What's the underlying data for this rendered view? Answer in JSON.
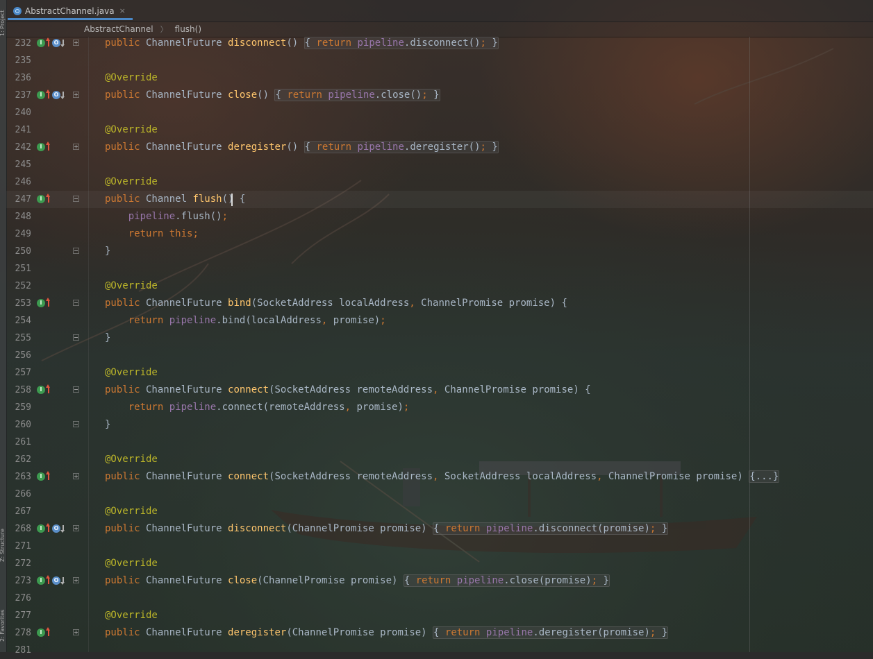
{
  "window": {
    "tab_label": "AbstractChannel.java",
    "tab_close": "×"
  },
  "breadcrumb": {
    "items": [
      "AbstractChannel",
      "flush()"
    ],
    "separator": "〉"
  },
  "tool_strip": {
    "labels": [
      "1: Project",
      "Z: Structure",
      "2: Favorites"
    ]
  },
  "colors": {
    "keyword": "#cc7832",
    "annotation": "#bbb529",
    "method": "#ffc66d",
    "field": "#9876aa",
    "text": "#a9b7c6",
    "line_number": "#8c8c8c",
    "tab_underline": "#4a88c7"
  },
  "gutter_legend": {
    "impl": "I",
    "over": "O"
  },
  "current_line": "247",
  "editor": {
    "lines": [
      {
        "num": "232",
        "markers": [
          "impl",
          "up",
          "over",
          "down"
        ],
        "fold": "plus",
        "tokens": [
          [
            "kw",
            "public"
          ],
          [
            "pl",
            " ChannelFuture "
          ],
          [
            "fn",
            "disconnect"
          ],
          [
            "pl",
            "() "
          ],
          [
            "fb",
            "{ "
          ],
          [
            "fbk",
            "return"
          ],
          [
            "fb",
            " "
          ],
          [
            "fbf",
            "pipeline"
          ],
          [
            "fb",
            ".disconnect()"
          ],
          [
            "fbp",
            ";"
          ],
          [
            "fb",
            " }"
          ]
        ]
      },
      {
        "num": "235",
        "markers": [],
        "fold": "",
        "tokens": []
      },
      {
        "num": "236",
        "markers": [],
        "fold": "",
        "tokens": [
          [
            "an",
            "@Override"
          ]
        ]
      },
      {
        "num": "237",
        "markers": [
          "impl",
          "up",
          "over",
          "down"
        ],
        "fold": "plus",
        "tokens": [
          [
            "kw",
            "public"
          ],
          [
            "pl",
            " ChannelFuture "
          ],
          [
            "fn",
            "close"
          ],
          [
            "pl",
            "() "
          ],
          [
            "fb",
            "{ "
          ],
          [
            "fbk",
            "return"
          ],
          [
            "fb",
            " "
          ],
          [
            "fbf",
            "pipeline"
          ],
          [
            "fb",
            ".close()"
          ],
          [
            "fbp",
            ";"
          ],
          [
            "fb",
            " }"
          ]
        ]
      },
      {
        "num": "240",
        "markers": [],
        "fold": "",
        "tokens": []
      },
      {
        "num": "241",
        "markers": [],
        "fold": "",
        "tokens": [
          [
            "an",
            "@Override"
          ]
        ]
      },
      {
        "num": "242",
        "markers": [
          "impl",
          "up"
        ],
        "fold": "plus",
        "tokens": [
          [
            "kw",
            "public"
          ],
          [
            "pl",
            " ChannelFuture "
          ],
          [
            "fn",
            "deregister"
          ],
          [
            "pl",
            "() "
          ],
          [
            "fb",
            "{ "
          ],
          [
            "fbk",
            "return"
          ],
          [
            "fb",
            " "
          ],
          [
            "fbf",
            "pipeline"
          ],
          [
            "fb",
            ".deregister()"
          ],
          [
            "fbp",
            ";"
          ],
          [
            "fb",
            " }"
          ]
        ]
      },
      {
        "num": "245",
        "markers": [],
        "fold": "",
        "tokens": []
      },
      {
        "num": "246",
        "markers": [],
        "fold": "",
        "tokens": [
          [
            "an",
            "@Override"
          ]
        ]
      },
      {
        "num": "247",
        "markers": [
          "impl",
          "up"
        ],
        "fold": "open",
        "tokens": [
          [
            "kw",
            "public"
          ],
          [
            "pl",
            " Channel "
          ],
          [
            "fn",
            "flush"
          ],
          [
            "pl",
            "() {"
          ]
        ]
      },
      {
        "num": "248",
        "markers": [],
        "fold": "",
        "tokens": [
          [
            "pl",
            "    "
          ],
          [
            "fld",
            "pipeline"
          ],
          [
            "pl",
            ".flush()"
          ],
          [
            "pu",
            ";"
          ]
        ]
      },
      {
        "num": "249",
        "markers": [],
        "fold": "",
        "tokens": [
          [
            "pl",
            "    "
          ],
          [
            "kw",
            "return this"
          ],
          [
            "pu",
            ";"
          ]
        ]
      },
      {
        "num": "250",
        "markers": [],
        "fold": "end",
        "tokens": [
          [
            "pl",
            "}"
          ]
        ]
      },
      {
        "num": "251",
        "markers": [],
        "fold": "",
        "tokens": []
      },
      {
        "num": "252",
        "markers": [],
        "fold": "",
        "tokens": [
          [
            "an",
            "@Override"
          ]
        ]
      },
      {
        "num": "253",
        "markers": [
          "impl",
          "up"
        ],
        "fold": "open",
        "tokens": [
          [
            "kw",
            "public"
          ],
          [
            "pl",
            " ChannelFuture "
          ],
          [
            "fn",
            "bind"
          ],
          [
            "pl",
            "(SocketAddress localAddress"
          ],
          [
            "pu",
            ","
          ],
          [
            "pl",
            " ChannelPromise promise) {"
          ]
        ]
      },
      {
        "num": "254",
        "markers": [],
        "fold": "",
        "tokens": [
          [
            "pl",
            "    "
          ],
          [
            "kw",
            "return "
          ],
          [
            "fld",
            "pipeline"
          ],
          [
            "pl",
            ".bind(localAddress"
          ],
          [
            "pu",
            ","
          ],
          [
            "pl",
            " promise)"
          ],
          [
            "pu",
            ";"
          ]
        ]
      },
      {
        "num": "255",
        "markers": [],
        "fold": "end",
        "tokens": [
          [
            "pl",
            "}"
          ]
        ]
      },
      {
        "num": "256",
        "markers": [],
        "fold": "",
        "tokens": []
      },
      {
        "num": "257",
        "markers": [],
        "fold": "",
        "tokens": [
          [
            "an",
            "@Override"
          ]
        ]
      },
      {
        "num": "258",
        "markers": [
          "impl",
          "up"
        ],
        "fold": "open",
        "tokens": [
          [
            "kw",
            "public"
          ],
          [
            "pl",
            " ChannelFuture "
          ],
          [
            "fn",
            "connect"
          ],
          [
            "pl",
            "(SocketAddress remoteAddress"
          ],
          [
            "pu",
            ","
          ],
          [
            "pl",
            " ChannelPromise promise) {"
          ]
        ]
      },
      {
        "num": "259",
        "markers": [],
        "fold": "",
        "tokens": [
          [
            "pl",
            "    "
          ],
          [
            "kw",
            "return "
          ],
          [
            "fld",
            "pipeline"
          ],
          [
            "pl",
            ".connect(remoteAddress"
          ],
          [
            "pu",
            ","
          ],
          [
            "pl",
            " promise)"
          ],
          [
            "pu",
            ";"
          ]
        ]
      },
      {
        "num": "260",
        "markers": [],
        "fold": "end",
        "tokens": [
          [
            "pl",
            "}"
          ]
        ]
      },
      {
        "num": "261",
        "markers": [],
        "fold": "",
        "tokens": []
      },
      {
        "num": "262",
        "markers": [],
        "fold": "",
        "tokens": [
          [
            "an",
            "@Override"
          ]
        ]
      },
      {
        "num": "263",
        "markers": [
          "impl",
          "up"
        ],
        "fold": "plus",
        "tokens": [
          [
            "kw",
            "public"
          ],
          [
            "pl",
            " ChannelFuture "
          ],
          [
            "fn",
            "connect"
          ],
          [
            "pl",
            "(SocketAddress remoteAddress"
          ],
          [
            "pu",
            ","
          ],
          [
            "pl",
            " SocketAddress localAddress"
          ],
          [
            "pu",
            ","
          ],
          [
            "pl",
            " ChannelPromise promise) "
          ],
          [
            "fb",
            "{...}"
          ]
        ]
      },
      {
        "num": "266",
        "markers": [],
        "fold": "",
        "tokens": []
      },
      {
        "num": "267",
        "markers": [],
        "fold": "",
        "tokens": [
          [
            "an",
            "@Override"
          ]
        ]
      },
      {
        "num": "268",
        "markers": [
          "impl",
          "up",
          "over",
          "down"
        ],
        "fold": "plus",
        "tokens": [
          [
            "kw",
            "public"
          ],
          [
            "pl",
            " ChannelFuture "
          ],
          [
            "fn",
            "disconnect"
          ],
          [
            "pl",
            "(ChannelPromise promise) "
          ],
          [
            "fb",
            "{ "
          ],
          [
            "fbk",
            "return"
          ],
          [
            "fb",
            " "
          ],
          [
            "fbf",
            "pipeline"
          ],
          [
            "fb",
            ".disconnect(promise)"
          ],
          [
            "fbp",
            ";"
          ],
          [
            "fb",
            " }"
          ]
        ]
      },
      {
        "num": "271",
        "markers": [],
        "fold": "",
        "tokens": []
      },
      {
        "num": "272",
        "markers": [],
        "fold": "",
        "tokens": [
          [
            "an",
            "@Override"
          ]
        ]
      },
      {
        "num": "273",
        "markers": [
          "impl",
          "up",
          "over",
          "down"
        ],
        "fold": "plus",
        "tokens": [
          [
            "kw",
            "public"
          ],
          [
            "pl",
            " ChannelFuture "
          ],
          [
            "fn",
            "close"
          ],
          [
            "pl",
            "(ChannelPromise promise) "
          ],
          [
            "fb",
            "{ "
          ],
          [
            "fbk",
            "return"
          ],
          [
            "fb",
            " "
          ],
          [
            "fbf",
            "pipeline"
          ],
          [
            "fb",
            ".close(promise)"
          ],
          [
            "fbp",
            ";"
          ],
          [
            "fb",
            " }"
          ]
        ]
      },
      {
        "num": "276",
        "markers": [],
        "fold": "",
        "tokens": []
      },
      {
        "num": "277",
        "markers": [],
        "fold": "",
        "tokens": [
          [
            "an",
            "@Override"
          ]
        ]
      },
      {
        "num": "278",
        "markers": [
          "impl",
          "up"
        ],
        "fold": "plus",
        "tokens": [
          [
            "kw",
            "public"
          ],
          [
            "pl",
            " ChannelFuture "
          ],
          [
            "fn",
            "deregister"
          ],
          [
            "pl",
            "(ChannelPromise promise) "
          ],
          [
            "fb",
            "{ "
          ],
          [
            "fbk",
            "return"
          ],
          [
            "fb",
            " "
          ],
          [
            "fbf",
            "pipeline"
          ],
          [
            "fb",
            ".deregister(promise)"
          ],
          [
            "fbp",
            ";"
          ],
          [
            "fb",
            " }"
          ]
        ]
      },
      {
        "num": "281",
        "markers": [],
        "fold": "",
        "tokens": []
      }
    ]
  }
}
